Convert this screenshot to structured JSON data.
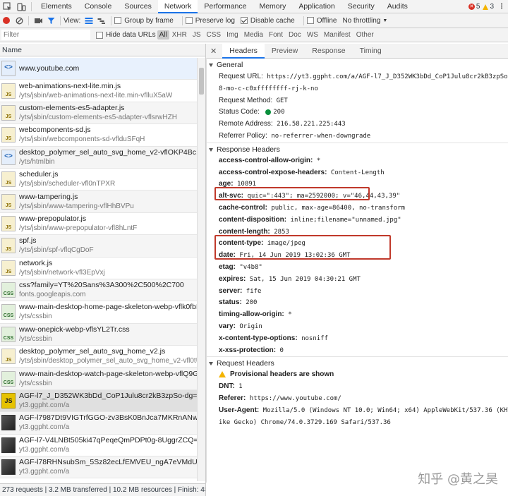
{
  "tabs": [
    "Elements",
    "Console",
    "Sources",
    "Network",
    "Performance",
    "Memory",
    "Application",
    "Security",
    "Audits"
  ],
  "errors": "5",
  "warnings": "3",
  "toolbar": {
    "view": "View:",
    "group_by_frame": "Group by frame",
    "preserve_log": "Preserve log",
    "disable_cache": "Disable cache",
    "offline": "Offline",
    "throttling": "No throttling"
  },
  "filter": {
    "placeholder": "Filter",
    "hide_data_urls": "Hide data URLs",
    "types": [
      "All",
      "XHR",
      "JS",
      "CSS",
      "Img",
      "Media",
      "Font",
      "Doc",
      "WS",
      "Manifest",
      "Other"
    ]
  },
  "name_header": "Name",
  "requests": [
    {
      "name": "www.youtube.com",
      "path": "",
      "type": "html"
    },
    {
      "name": "web-animations-next-lite.min.js",
      "path": "/yts/jsbin/web-animations-next-lite.min-vflluX5aW",
      "type": "js"
    },
    {
      "name": "custom-elements-es5-adapter.js",
      "path": "/yts/jsbin/custom-elements-es5-adapter-vflsrwHZH",
      "type": "js"
    },
    {
      "name": "webcomponents-sd.js",
      "path": "/yts/jsbin/webcomponents-sd-vflduSFqH",
      "type": "js"
    },
    {
      "name": "desktop_polymer_sel_auto_svg_home_v2-vflOKP4Bc.html",
      "path": "/yts/htmlbin",
      "type": "html"
    },
    {
      "name": "scheduler.js",
      "path": "/yts/jsbin/scheduler-vfl0nTPXR",
      "type": "js"
    },
    {
      "name": "www-tampering.js",
      "path": "/yts/jsbin/www-tampering-vflHhBVPu",
      "type": "js"
    },
    {
      "name": "www-prepopulator.js",
      "path": "/yts/jsbin/www-prepopulator-vfl8hLntF",
      "type": "js"
    },
    {
      "name": "spf.js",
      "path": "/yts/jsbin/spf-vflqCgDoF",
      "type": "js"
    },
    {
      "name": "network.js",
      "path": "/yts/jsbin/network-vfl3EpVxj",
      "type": "js"
    },
    {
      "name": "css?family=YT%20Sans%3A300%2C500%2C700",
      "path": "fonts.googleapis.com",
      "type": "css"
    },
    {
      "name": "www-main-desktop-home-page-skeleton-webp-vflk0fbB5.css",
      "path": "/yts/cssbin",
      "type": "css"
    },
    {
      "name": "www-onepick-webp-vflsYL2Tr.css",
      "path": "/yts/cssbin",
      "type": "css"
    },
    {
      "name": "desktop_polymer_sel_auto_svg_home_v2.js",
      "path": "/yts/jsbin/desktop_polymer_sel_auto_svg_home_v2-vfl0tU-AS",
      "type": "js"
    },
    {
      "name": "www-main-desktop-watch-page-skeleton-webp-vflQ9GNSj.css",
      "path": "/yts/cssbin",
      "type": "css"
    },
    {
      "name": "AGF-l7_J_D352WK3bDd_CoP1Julu8cr2kB3zpSo-dg=s88-mo-c-c0xffffffff-rj-k-no",
      "path": "yt3.ggpht.com/a",
      "type": "jsy"
    },
    {
      "name": "AGF-l7987Dt9VIGTrfGGO-zv3BsK0BnJca7MKRnANw=s88-mo-c-c0xffffffff-rj-k-no",
      "path": "yt3.ggpht.com/a",
      "type": "img"
    },
    {
      "name": "AGF-l7-V4LNBt505ki47qPeqeQmPDPt0g-8UggrZCQ=s88-mo-c-c0xffffffff-rj-k-no",
      "path": "yt3.ggpht.com/a",
      "type": "img"
    },
    {
      "name": "AGF-l78RHNsubSm_5Sz82ecLfEMVEU_ngA7eVMdU2A=s88-mo-c-c0xffffffff-rj-k-no",
      "path": "yt3.ggpht.com/a",
      "type": "img"
    }
  ],
  "status": {
    "requests": "273 requests",
    "transferred": "3.2 MB transferred",
    "resources": "10.2 MB resources",
    "finish": "Finish: 48.6 s"
  },
  "detail_tabs": [
    "Headers",
    "Preview",
    "Response",
    "Timing"
  ],
  "general": {
    "title": "General",
    "rows": [
      {
        "k": "Request URL:",
        "v": "https://yt3.ggpht.com/a/AGF-l7_J_D352WK3bDd_CoP1Julu8cr2kB3zpSo-dg=s8"
      },
      {
        "k": "",
        "v": "8-mo-c-c0xffffffff-rj-k-no"
      },
      {
        "k": "Request Method:",
        "v": "GET"
      },
      {
        "k": "Status Code:",
        "v": "200"
      },
      {
        "k": "Remote Address:",
        "v": "216.58.221.225:443"
      },
      {
        "k": "Referrer Policy:",
        "v": "no-referrer-when-downgrade"
      }
    ]
  },
  "response_headers": {
    "title": "Response Headers",
    "rows": [
      {
        "k": "access-control-allow-origin:",
        "v": "*"
      },
      {
        "k": "access-control-expose-headers:",
        "v": "Content-Length"
      },
      {
        "k": "age:",
        "v": "10891"
      },
      {
        "k": "alt-svc:",
        "v": "quic=\":443\"; ma=2592000; v=\"46,44,43,39\""
      },
      {
        "k": "cache-control:",
        "v": "public, max-age=86400, no-transform"
      },
      {
        "k": "content-disposition:",
        "v": "inline;filename=\"unnamed.jpg\""
      },
      {
        "k": "content-length:",
        "v": "2853"
      },
      {
        "k": "content-type:",
        "v": "image/jpeg"
      },
      {
        "k": "date:",
        "v": "Fri, 14 Jun 2019 13:02:36 GMT"
      },
      {
        "k": "etag:",
        "v": "\"v4b8\""
      },
      {
        "k": "expires:",
        "v": "Sat, 15 Jun 2019 04:30:21 GMT"
      },
      {
        "k": "server:",
        "v": "fife"
      },
      {
        "k": "status:",
        "v": "200"
      },
      {
        "k": "timing-allow-origin:",
        "v": "*"
      },
      {
        "k": "vary:",
        "v": "Origin"
      },
      {
        "k": "x-content-type-options:",
        "v": "nosniff"
      },
      {
        "k": "x-xss-protection:",
        "v": "0"
      }
    ]
  },
  "request_headers": {
    "title": "Request Headers",
    "provisional": "Provisional headers are shown",
    "rows": [
      {
        "k": "DNT:",
        "v": "1"
      },
      {
        "k": "Referer:",
        "v": "https://www.youtube.com/"
      },
      {
        "k": "User-Agent:",
        "v": "Mozilla/5.0 (Windows NT 10.0; Win64; x64) AppleWebKit/537.36 (KHTML, l"
      },
      {
        "k": "",
        "v": "ike Gecko) Chrome/74.0.3729.169 Safari/537.36"
      }
    ]
  },
  "watermark": "知乎 @黄之昊"
}
